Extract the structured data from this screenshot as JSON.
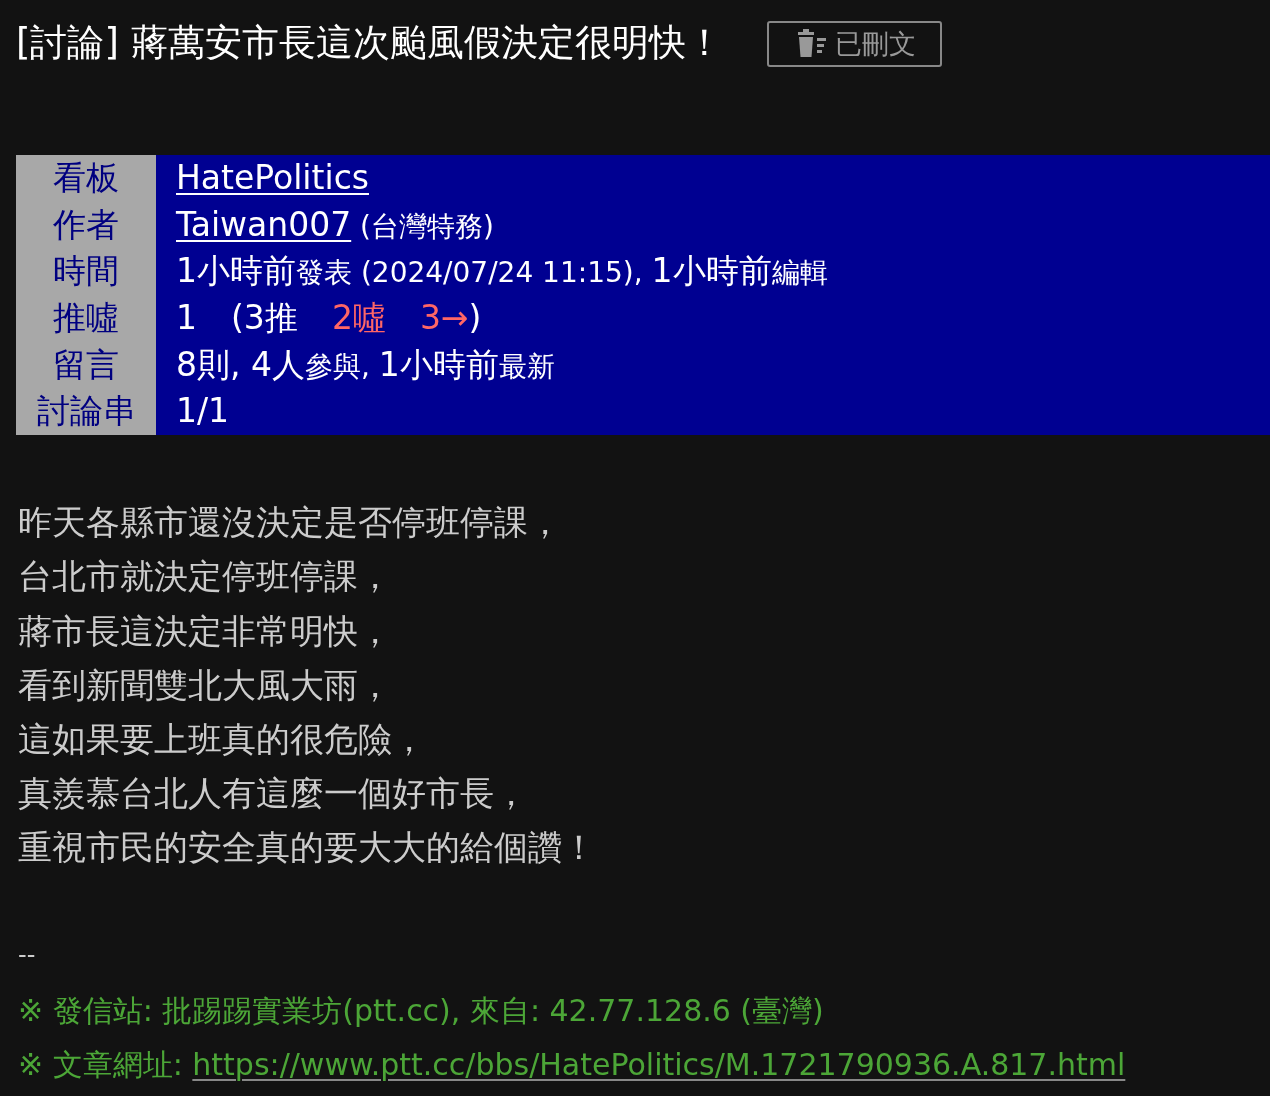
{
  "title": "[討論] 蔣萬安市長這次颱風假決定很明快！",
  "deleted_badge": {
    "label": "已刪文"
  },
  "meta": [
    {
      "label": "看板",
      "value": [
        {
          "kind": "link",
          "text": "HatePolitics"
        }
      ]
    },
    {
      "label": "作者",
      "value": [
        {
          "kind": "link",
          "text": "Taiwan007"
        },
        {
          "kind": "small",
          "text": " (台灣特務)"
        }
      ]
    },
    {
      "label": "時間",
      "value": [
        {
          "kind": "plain",
          "text": "1小時前"
        },
        {
          "kind": "small",
          "text": "發表 (2024/07/24 11:15), "
        },
        {
          "kind": "plain",
          "text": "1小時前"
        },
        {
          "kind": "small",
          "text": "編輯"
        }
      ]
    },
    {
      "label": "推噓",
      "value": [
        {
          "kind": "plain",
          "text": "1"
        },
        {
          "kind": "plain",
          "text": "(3推"
        },
        {
          "kind": "boo",
          "text": "2噓"
        },
        {
          "kind": "boo",
          "text": "3→"
        },
        {
          "kind": "plain",
          "text": ")"
        }
      ]
    },
    {
      "label": "留言",
      "value": [
        {
          "kind": "plain",
          "text": "8則, 4人"
        },
        {
          "kind": "small",
          "text": "參與, "
        },
        {
          "kind": "plain",
          "text": "1小時前"
        },
        {
          "kind": "small",
          "text": "最新"
        }
      ]
    },
    {
      "label": "討論串",
      "value": [
        {
          "kind": "plain",
          "text": "1/1"
        }
      ]
    }
  ],
  "body": [
    "昨天各縣市還沒決定是否停班停課，",
    "台北市就決定停班停課，",
    "蔣市長這決定非常明快，",
    "看到新聞雙北大風大雨，",
    "這如果要上班真的很危險，",
    "真羨慕台北人有這麼一個好市長，",
    "重視市民的安全真的要大大的給個讚！"
  ],
  "signature": "--",
  "footer": [
    {
      "kind": "text",
      "text": "※ 發信站: 批踢踢實業坊(ptt.cc), 來自: 42.77.128.6 (臺灣)"
    },
    {
      "kind": "url",
      "label": "※ 文章網址: ",
      "url": "https://www.ptt.cc/bbs/HatePolitics/M.1721790936.A.817.html"
    }
  ]
}
